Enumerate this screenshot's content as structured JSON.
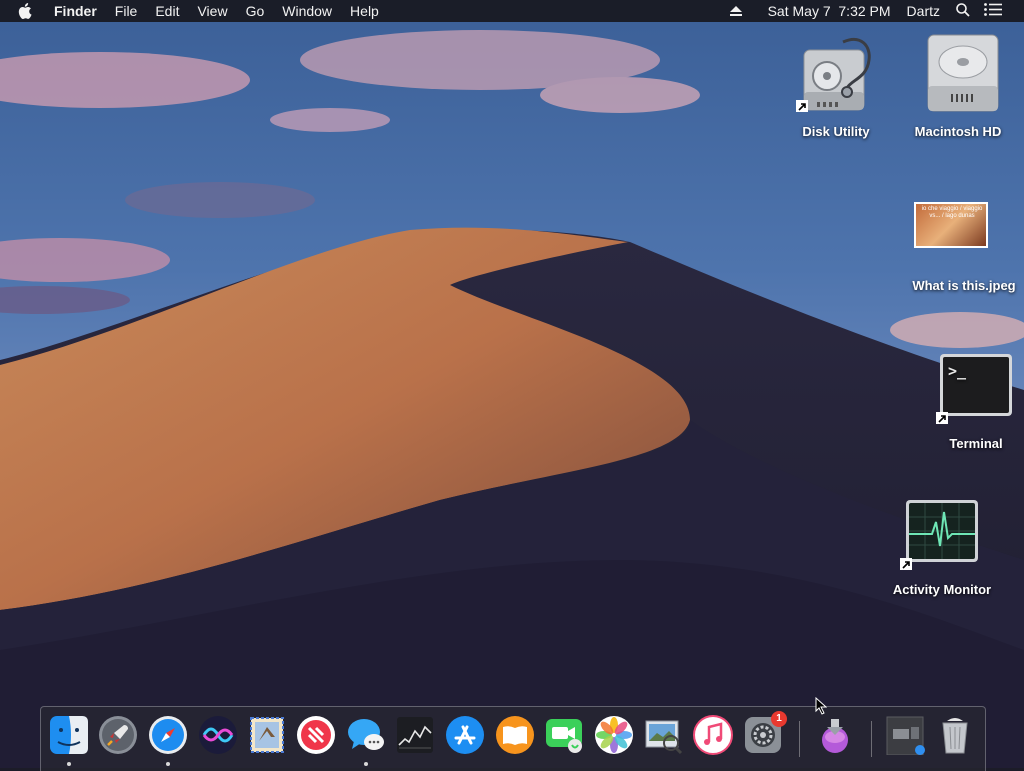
{
  "menubar": {
    "apple_icon": "apple-logo-icon",
    "active_app": "Finder",
    "menus": [
      "File",
      "Edit",
      "View",
      "Go",
      "Window",
      "Help"
    ],
    "eject_icon": "eject-icon",
    "clock": "Sat May 7  7:32 PM",
    "user": "Dartz",
    "spotlight_icon": "search-icon",
    "notification_icon": "notification-center-icon"
  },
  "desktop": {
    "icons": [
      {
        "label": "Disk Utility",
        "icon": "disk-utility-icon",
        "alias": true
      },
      {
        "label": "Macintosh HD",
        "icon": "hard-drive-icon",
        "alias": false
      },
      {
        "label": "What is this.jpeg",
        "icon": "image-thumbnail-icon",
        "alias": false
      },
      {
        "label": "Terminal",
        "icon": "terminal-icon",
        "alias": true
      },
      {
        "label": "Activity Monitor",
        "icon": "activity-monitor-icon",
        "alias": true
      }
    ],
    "thumbnail_caption": "io che viaggio / viaggio vs... / lago dunas"
  },
  "dock": {
    "apps": [
      {
        "name": "Finder",
        "icon": "finder-icon",
        "running": true
      },
      {
        "name": "Launchpad",
        "icon": "launchpad-icon",
        "running": true
      },
      {
        "name": "Safari",
        "icon": "safari-icon",
        "running": false
      },
      {
        "name": "Siri",
        "icon": "siri-icon",
        "running": false
      },
      {
        "name": "Mail",
        "icon": "mail-icon",
        "running": false
      },
      {
        "name": "News",
        "icon": "news-icon",
        "running": false
      },
      {
        "name": "Messages",
        "icon": "messages-icon",
        "running": true
      },
      {
        "name": "Stocks",
        "icon": "stocks-icon",
        "running": false
      },
      {
        "name": "App Store",
        "icon": "app-store-icon",
        "running": false
      },
      {
        "name": "Books",
        "icon": "books-icon",
        "running": false
      },
      {
        "name": "FaceTime",
        "icon": "facetime-icon",
        "running": false
      },
      {
        "name": "Photos",
        "icon": "photos-icon",
        "running": false
      },
      {
        "name": "Preview",
        "icon": "preview-icon",
        "running": false
      },
      {
        "name": "iTunes",
        "icon": "itunes-icon",
        "running": false
      },
      {
        "name": "System Preferences",
        "icon": "system-preferences-icon",
        "running": false,
        "badge": "1"
      },
      {
        "name": "Installer",
        "icon": "installer-icon",
        "running": false
      },
      {
        "name": "Downloads",
        "icon": "downloads-stack-icon",
        "running": false
      },
      {
        "name": "Trash",
        "icon": "trash-icon",
        "running": false
      }
    ]
  }
}
